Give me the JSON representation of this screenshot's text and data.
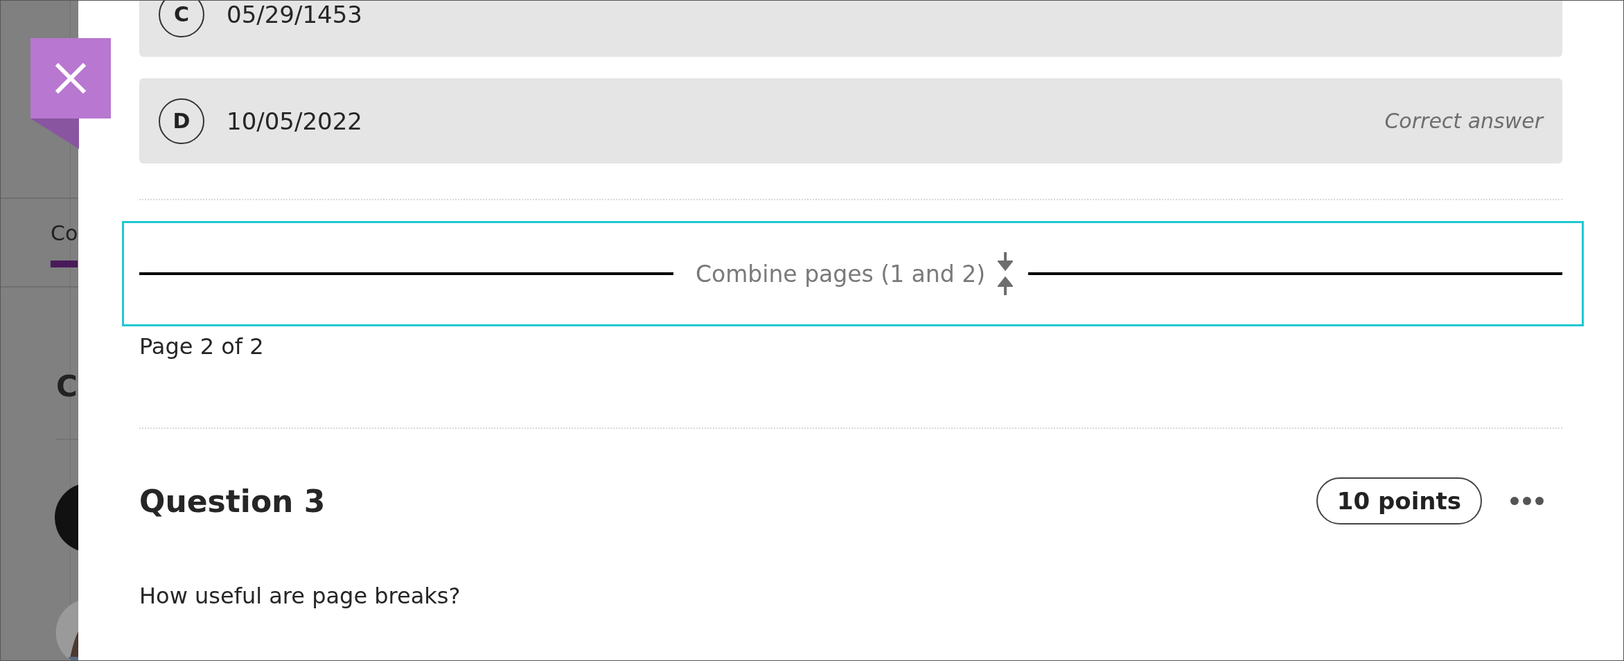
{
  "background": {
    "tab": "Co",
    "tab_selected": true,
    "heading": "C"
  },
  "options": [
    {
      "letter": "C",
      "text": "05/29/1453"
    },
    {
      "letter": "D",
      "text": "10/05/2022",
      "note": "Correct answer"
    }
  ],
  "page_break": {
    "label": "Combine pages (1 and 2)",
    "focused": true
  },
  "page_label": "Page 2 of 2",
  "question": {
    "title": "Question 3",
    "points": "10 points",
    "text": "How useful are page breaks?"
  }
}
